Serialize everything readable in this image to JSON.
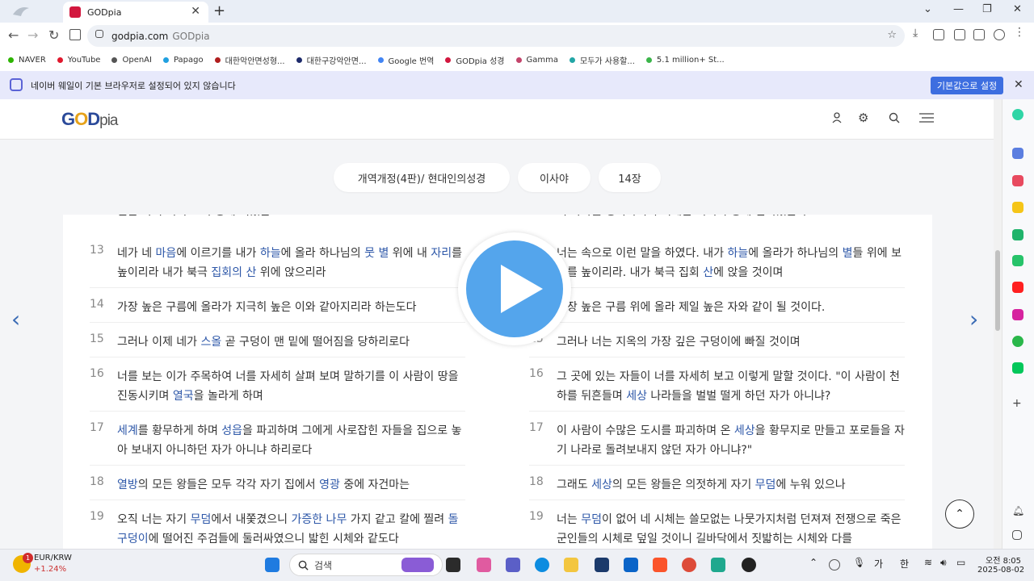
{
  "browser": {
    "tab_title": "GODpia",
    "tab_close": "✕",
    "new_tab": "+",
    "url_domain": "godpia.com",
    "url_title": "GODpia",
    "nav": {
      "back": "←",
      "forward": "→",
      "reload": "↻"
    },
    "window": {
      "minimize": "—",
      "restore": "❐",
      "close": "✕",
      "dropdown": "⌄"
    }
  },
  "bookmarks": [
    {
      "label": "NAVER",
      "color": "#2db400"
    },
    {
      "label": "YouTube",
      "color": "#e0182d"
    },
    {
      "label": "OpenAI",
      "color": "#555555"
    },
    {
      "label": "Papago",
      "color": "#20a0e0"
    },
    {
      "label": "대한악안면성형...",
      "color": "#b01e1e"
    },
    {
      "label": "대한구강악안면...",
      "color": "#1d2a6b"
    },
    {
      "label": "Google 번역",
      "color": "#4285f4"
    },
    {
      "label": "GODpia 성경",
      "color": "#d2173e"
    },
    {
      "label": "Gamma",
      "color": "#c4446b"
    },
    {
      "label": "모두가 사용할...",
      "color": "#22a6a6"
    },
    {
      "label": "5.1 million+ St...",
      "color": "#3bb54a"
    }
  ],
  "infobar": {
    "message": "네이버 웨일이 기본 브라우저로 설정되어 있지 않습니다",
    "button": "기본값으로 설정",
    "close": "✕"
  },
  "site": {
    "logo": {
      "g": "G",
      "o": "O",
      "d": "D",
      "pia": "pia"
    },
    "pills": {
      "version": "개역개정(4판)/ 현대인의성경",
      "book": "이사야",
      "chapter": "14장"
    },
    "prev_arrow": "‹",
    "next_arrow": "›",
    "scroll_top": "⌃"
  },
  "verses_left": [
    {
      "num": "",
      "text": "엎은 자여 어찌 그리 땅에 찍혔는고"
    },
    {
      "num": "13",
      "parts": [
        [
          "네가 네 ",
          0
        ],
        [
          "마음",
          1
        ],
        [
          "에 이르기를 내가 ",
          0
        ],
        [
          "하늘",
          1
        ],
        [
          "에 올라 하나님의 ",
          0
        ],
        [
          "뭇 별",
          1
        ],
        [
          " 위에 내 ",
          0
        ],
        [
          "자리",
          1
        ],
        [
          "를 높이리라 내가 북극 ",
          0
        ],
        [
          "집회의 산",
          1
        ],
        [
          " 위에 앉으리라",
          0
        ]
      ]
    },
    {
      "num": "14",
      "parts": [
        [
          "가장 높은 구름에 올라가 지극히 높은 이와 같아지리라 하는도다",
          0
        ]
      ]
    },
    {
      "num": "15",
      "parts": [
        [
          "그러나 이제 네가 ",
          0
        ],
        [
          "스올",
          1
        ],
        [
          " 곧 구덩이 맨 밑에 떨어짐을 당하리로다",
          0
        ]
      ]
    },
    {
      "num": "16",
      "parts": [
        [
          "너를 보는 이가 주목하여 너를 자세히 살펴 보며 말하기를 이 사람이 땅을 진동시키며 ",
          0
        ],
        [
          "열국",
          1
        ],
        [
          "을 놀라게 하며",
          0
        ]
      ]
    },
    {
      "num": "17",
      "parts": [
        [
          "세계",
          1
        ],
        [
          "를 황무하게 하며 ",
          0
        ],
        [
          "성읍",
          1
        ],
        [
          "을 파괴하며 그에게 사로잡힌 자들을 집으로 놓아 보내지 아니하던 자가 아니냐 하리로다",
          0
        ]
      ]
    },
    {
      "num": "18",
      "parts": [
        [
          "열방",
          1
        ],
        [
          "의 모든 왕들은 모두 각각 자기 집에서 ",
          0
        ],
        [
          "영광",
          1
        ],
        [
          " 중에 자건마는",
          0
        ]
      ]
    },
    {
      "num": "19",
      "parts": [
        [
          "오직 너는 자기 ",
          0
        ],
        [
          "무덤",
          1
        ],
        [
          "에서 내쫓겼으니 ",
          0
        ],
        [
          "가증한 나무",
          1
        ],
        [
          " 가지 같고 칼에 찔려 ",
          0
        ],
        [
          "돌구덩이",
          1
        ],
        [
          "에 떨어진 주검들에 둘러싸였으니 밟힌 시체와 같도다",
          0
        ]
      ]
    }
  ],
  "verses_right": [
    {
      "num": "",
      "text": "러 나라를 정복하더니 이제는 어쩌서 땅에 던져졌는냐?"
    },
    {
      "num": "13",
      "parts": [
        [
          "너는 속으로 이런 말을 하였다. 내가 ",
          0
        ],
        [
          "하늘",
          1
        ],
        [
          "에 올라가 하나님의 ",
          0
        ],
        [
          "별",
          1
        ],
        [
          "들 위에 보좌를 높이리라. 내가 북극 집회 ",
          0
        ],
        [
          "산",
          1
        ],
        [
          "에 앉을 것이며",
          0
        ]
      ]
    },
    {
      "num": "14",
      "parts": [
        [
          "가장 높은 구름 위에 올라 제일 높은 자와 같이 될 것이다.",
          0
        ]
      ]
    },
    {
      "num": "15",
      "parts": [
        [
          "그러나 너는 지옥의 가장 깊은 구덩이에 빠질 것이며",
          0
        ]
      ]
    },
    {
      "num": "16",
      "parts": [
        [
          "그 곳에 있는 자들이 너를 자세히 보고 이렇게 말할 것이다. \"이 사람이 천하를 뒤흔들며 ",
          0
        ],
        [
          "세상",
          1
        ],
        [
          " 나라들을 벌벌 떨게 하던 자가 아니냐?",
          0
        ]
      ]
    },
    {
      "num": "17",
      "parts": [
        [
          "이 사람이 수많은 도시를 파괴하며 온 ",
          0
        ],
        [
          "세상",
          1
        ],
        [
          "을 황무지로 만들고 포로들을 자기 나라로 돌려보내지 않던 자가 아니냐?\"",
          0
        ]
      ]
    },
    {
      "num": "18",
      "parts": [
        [
          "그래도 ",
          0
        ],
        [
          "세상",
          1
        ],
        [
          "의 모든 왕들은 의젓하게 자기 ",
          0
        ],
        [
          "무덤",
          1
        ],
        [
          "에 누워 있으나",
          0
        ]
      ]
    },
    {
      "num": "19",
      "parts": [
        [
          "너는 ",
          0
        ],
        [
          "무덤",
          1
        ],
        [
          "이 없어 네 시체는 쓸모없는 나뭇가지처럼 던져져 전쟁으로 죽은 군인들의 시체로 덮일 것이니 길바닥에서 짓밟히는 시체와 다를",
          0
        ]
      ]
    }
  ],
  "taskbar": {
    "weather_currency": "EUR/KRW",
    "weather_change": "+1.24%",
    "badge": "1",
    "search_placeholder": "검색",
    "time": "오전 8:05",
    "date": "2025-08-02",
    "ime1": "가",
    "ime2": "한"
  }
}
